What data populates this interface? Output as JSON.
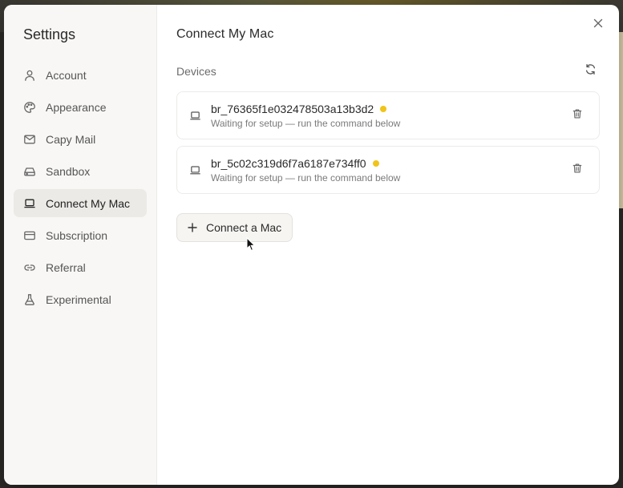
{
  "sidebar": {
    "title": "Settings",
    "items": [
      {
        "label": "Account",
        "icon": "user-icon"
      },
      {
        "label": "Appearance",
        "icon": "palette-icon"
      },
      {
        "label": "Capy Mail",
        "icon": "mail-icon"
      },
      {
        "label": "Sandbox",
        "icon": "drive-icon"
      },
      {
        "label": "Connect My Mac",
        "icon": "laptop-icon",
        "active": true
      },
      {
        "label": "Subscription",
        "icon": "credit-card-icon"
      },
      {
        "label": "Referral",
        "icon": "link-icon"
      },
      {
        "label": "Experimental",
        "icon": "flask-icon"
      }
    ]
  },
  "main": {
    "title": "Connect My Mac",
    "devices_label": "Devices",
    "devices": [
      {
        "name": "br_76365f1e032478503a13b3d2",
        "status": "Waiting for setup — run the command below"
      },
      {
        "name": "br_5c02c319d6f7a6187e734ff0",
        "status": "Waiting for setup — run the command below"
      }
    ],
    "connect_label": "Connect a Mac"
  },
  "colors": {
    "status_pending": "#f0c419",
    "sidebar_bg": "#f8f7f5",
    "active_bg": "#ebeae6"
  }
}
